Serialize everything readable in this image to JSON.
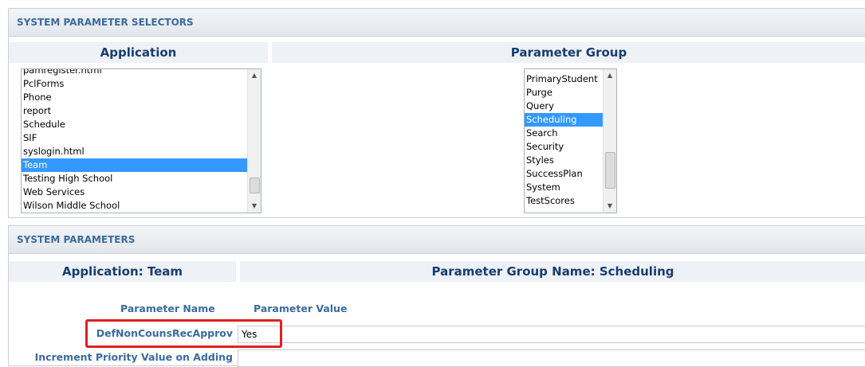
{
  "selectors": {
    "header": "SYSTEM PARAMETER SELECTORS",
    "application_header": "Application",
    "parameter_group_header": "Parameter Group",
    "application_items": [
      {
        "label": "pamregister.html",
        "selected": false
      },
      {
        "label": "PclForms",
        "selected": false
      },
      {
        "label": "Phone",
        "selected": false
      },
      {
        "label": "report",
        "selected": false
      },
      {
        "label": "Schedule",
        "selected": false
      },
      {
        "label": "SIF",
        "selected": false
      },
      {
        "label": "syslogin.html",
        "selected": false
      },
      {
        "label": "Team",
        "selected": true
      },
      {
        "label": "Testing High School",
        "selected": false
      },
      {
        "label": "Web Services",
        "selected": false
      },
      {
        "label": "Wilson Middle School",
        "selected": false
      }
    ],
    "group_items": [
      {
        "label": "PrimaryStudent",
        "selected": false
      },
      {
        "label": "Purge",
        "selected": false
      },
      {
        "label": "Query",
        "selected": false
      },
      {
        "label": "Scheduling",
        "selected": true
      },
      {
        "label": "Search",
        "selected": false
      },
      {
        "label": "Security",
        "selected": false
      },
      {
        "label": "Styles",
        "selected": false
      },
      {
        "label": "SuccessPlan",
        "selected": false
      },
      {
        "label": "System",
        "selected": false
      },
      {
        "label": "TestScores",
        "selected": false
      }
    ]
  },
  "parameters": {
    "header": "SYSTEM PARAMETERS",
    "application_label": "Application: Team",
    "group_label": "Parameter Group Name: Scheduling",
    "col_name": "Parameter Name",
    "col_value": "Parameter Value",
    "rows": [
      {
        "name": "DefNonCounsRecApprov",
        "value": "Yes"
      },
      {
        "name": "Increment Priority Value on Adding",
        "value": ""
      }
    ]
  },
  "colors": {
    "accent": "#3a6b9c",
    "heading": "#173d70",
    "selection": "#3399ff",
    "highlight": "#e02020"
  }
}
